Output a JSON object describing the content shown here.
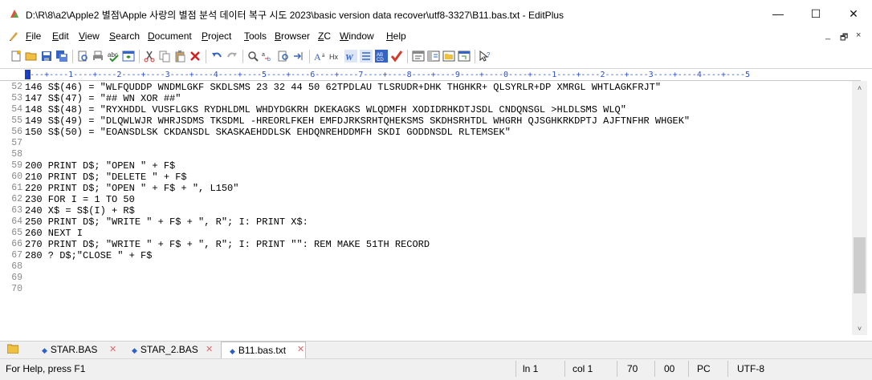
{
  "window": {
    "title": "D:\\R\\8\\a2\\Apple2 별점\\Apple 사랑의 별점 분석 데이터 복구 시도 2023\\basic version data recover\\utf8-3327\\B11.bas.txt - EditPlus",
    "minimize_glyph": "—",
    "maximize_glyph": "☐",
    "close_glyph": "✕"
  },
  "menu": {
    "items": [
      {
        "accel": "F",
        "rest": "ile"
      },
      {
        "accel": "E",
        "rest": "dit"
      },
      {
        "accel": "V",
        "rest": "iew"
      },
      {
        "accel": "S",
        "rest": "earch"
      },
      {
        "accel": "D",
        "rest": "ocument"
      },
      {
        "accel": "P",
        "rest": "roject"
      },
      {
        "accel": "T",
        "rest": "ools"
      },
      {
        "accel": "B",
        "rest": "rowser"
      },
      {
        "accel": "Z",
        "rest": "C"
      },
      {
        "accel": "W",
        "rest": "indow"
      },
      {
        "accel": "H",
        "rest": "elp"
      }
    ],
    "mdi_minimize": "_",
    "mdi_restore": "🗗",
    "mdi_close": "×"
  },
  "toolbar": {
    "icons": [
      "new-file-icon",
      "open-file-icon",
      "save-icon",
      "save-all-icon",
      "print-preview-icon",
      "print-icon",
      "spell-check-icon",
      "browser-icon",
      "cut-icon",
      "copy-icon",
      "paste-icon",
      "delete-icon",
      "undo-icon",
      "redo-icon",
      "find-icon",
      "replace-icon",
      "find-in-files-icon",
      "goto-icon",
      "font-size-icon",
      "hex-icon",
      "word-wrap-icon",
      "line-number-icon",
      "column-select-icon",
      "check-icon",
      "user-tool-icon",
      "cliptext-icon",
      "directory-icon",
      "full-screen-icon",
      "help-icon"
    ]
  },
  "ruler": {
    "text": "----+----1----+----2----+----3----+----4----+----5----+----6----+----7----+----8----+----9----+----0----+----1----+----2----+----3----+----4----+----5"
  },
  "editor": {
    "lines": [
      {
        "num": "52",
        "text": "146 S$(46) = \"WLFQUDDP WNDMLGKF SKDLSMS 23 32 44 50 62TPDLAU TLSRUDR+DHK THGHKR+ QLSYRLR+DP XMRGL WHTLAGKFRJT\""
      },
      {
        "num": "53",
        "text": "147 S$(47) = \"## WN XOR ##\""
      },
      {
        "num": "54",
        "text": "148 S$(48) = \"RYXHDDL VUSFLGKS RYDHLDML WHDYDGKRH DKEKAGKS WLQDMFH XODIDRHKDTJSDL CNDQNSGL >HLDLSMS WLQ\""
      },
      {
        "num": "55",
        "text": "149 S$(49) = \"DLQWLWJR WHRJSDMS TKSDML -HREORLFKEH EMFDJRKSRHTQHEKSMS SKDHSRHTDL WHGRH QJSGHKRKDPTJ AJFTNFHR WHGEK\""
      },
      {
        "num": "56",
        "text": "150 S$(50) = \"EOANSDLSK CKDANSDL SKASKAEHDDLSK EHDQNREHDDMFH SKDI GODDNSDL RLTEMSEK\""
      },
      {
        "num": "57",
        "text": ""
      },
      {
        "num": "58",
        "text": ""
      },
      {
        "num": "59",
        "text": "200 PRINT D$; \"OPEN \" + F$"
      },
      {
        "num": "60",
        "text": "210 PRINT D$; \"DELETE \" + F$"
      },
      {
        "num": "61",
        "text": "220 PRINT D$; \"OPEN \" + F$ + \", L150\""
      },
      {
        "num": "62",
        "text": "230 FOR I = 1 TO 50"
      },
      {
        "num": "63",
        "text": "240 X$ = S$(I) + R$"
      },
      {
        "num": "64",
        "text": "250 PRINT D$; \"WRITE \" + F$ + \", R\"; I: PRINT X$:"
      },
      {
        "num": "65",
        "text": "260 NEXT I"
      },
      {
        "num": "66",
        "text": "270 PRINT D$; \"WRITE \" + F$ + \", R\"; I: PRINT \"\": REM MAKE 51TH RECORD"
      },
      {
        "num": "67",
        "text": "280 ? D$;\"CLOSE \" + F$"
      },
      {
        "num": "68",
        "text": ""
      },
      {
        "num": "69",
        "text": ""
      },
      {
        "num": "70",
        "text": ""
      }
    ]
  },
  "scrollbar": {
    "up_glyph": "˄",
    "down_glyph": "˅"
  },
  "tabs": [
    {
      "label": "STAR.BAS",
      "active": false
    },
    {
      "label": "STAR_2.BAS",
      "active": false
    },
    {
      "label": "B11.bas.txt",
      "active": true
    }
  ],
  "tab_doc_glyph": "◆",
  "tab_close_glyph": "✕",
  "status": {
    "help": "For Help, press F1",
    "ln": "ln 1",
    "col": "col 1",
    "count": "70",
    "ovr": "00",
    "mode": "PC",
    "encoding": "UTF-8"
  },
  "colors": {
    "ruler": "#2b4fcf",
    "line_number": "#8a8a8a",
    "accent": "#1c3fbf"
  }
}
